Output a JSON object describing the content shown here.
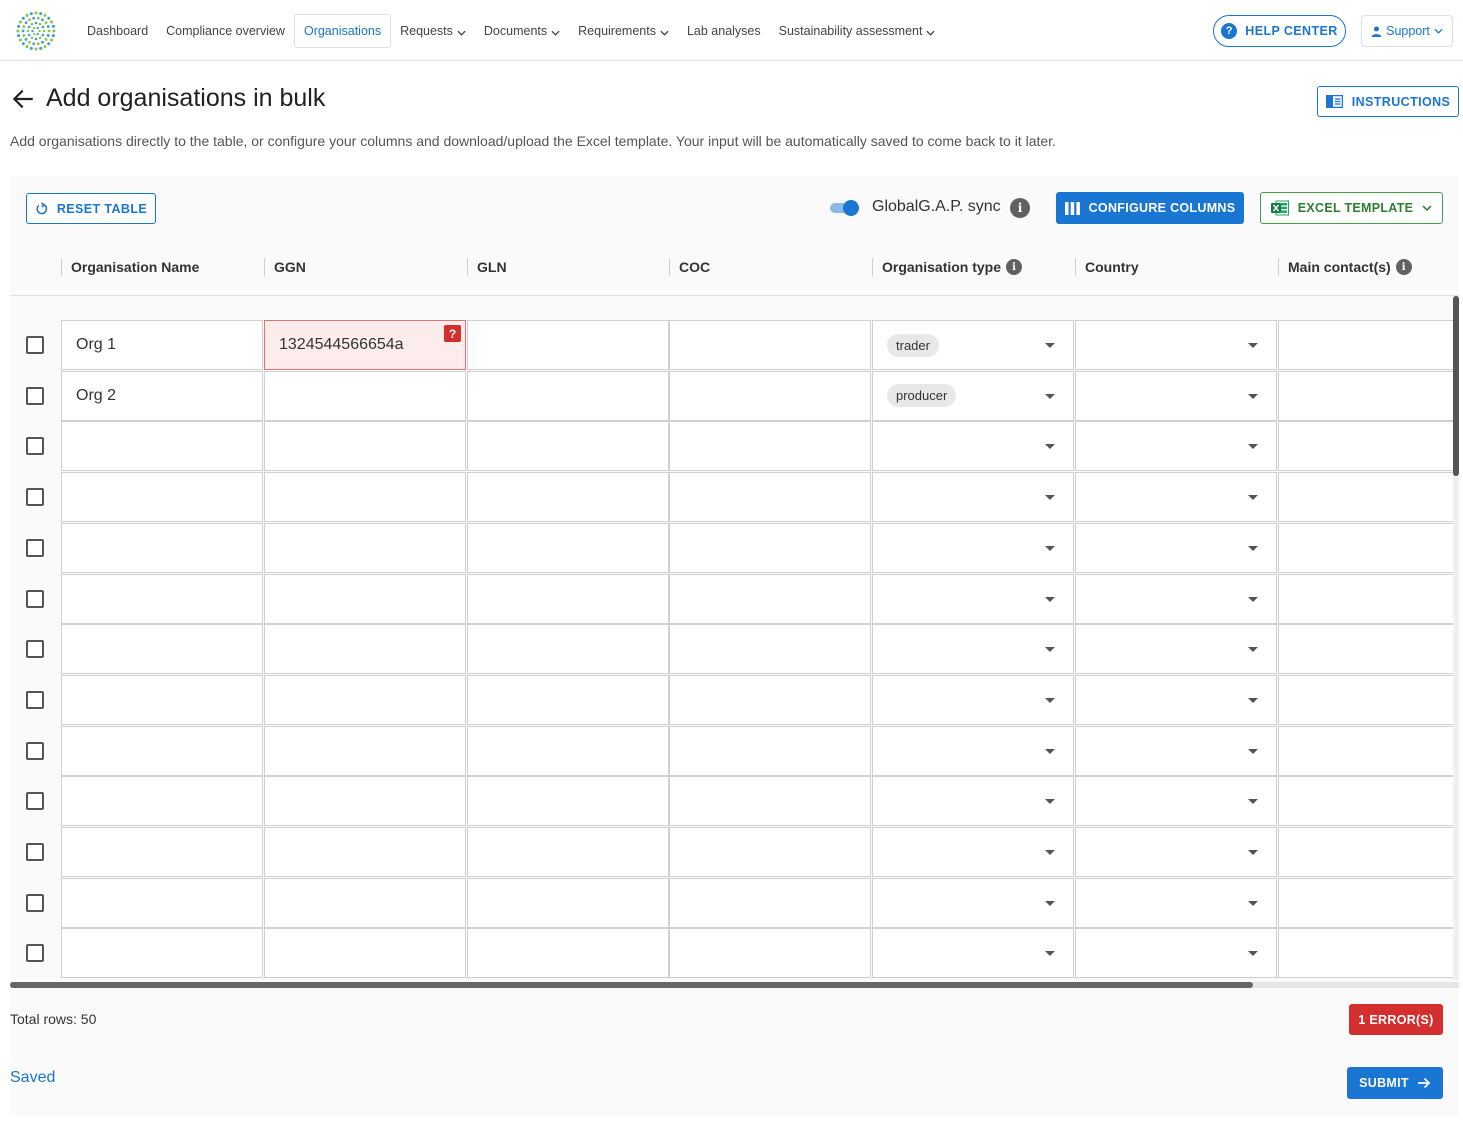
{
  "nav": {
    "items": [
      {
        "label": "Dashboard",
        "dropdown": false,
        "active": false
      },
      {
        "label": "Compliance overview",
        "dropdown": false,
        "active": false
      },
      {
        "label": "Organisations",
        "dropdown": false,
        "active": true
      },
      {
        "label": "Requests",
        "dropdown": true,
        "active": false
      },
      {
        "label": "Documents",
        "dropdown": true,
        "active": false
      },
      {
        "label": "Requirements",
        "dropdown": true,
        "active": false
      },
      {
        "label": "Lab analyses",
        "dropdown": false,
        "active": false
      },
      {
        "label": "Sustainability assessment",
        "dropdown": true,
        "active": false
      }
    ],
    "help_label": "HELP CENTER",
    "support_label": "Support"
  },
  "page": {
    "title": "Add organisations in bulk",
    "instructions_label": "INSTRUCTIONS",
    "description": "Add organisations directly to the table, or configure your columns and download/upload the Excel template. Your input will be automatically saved to come back to it later."
  },
  "toolbar": {
    "reset_label": "RESET TABLE",
    "sync_label": "GlobalG.A.P. sync",
    "sync_enabled": true,
    "configure_label": "CONFIGURE COLUMNS",
    "excel_label": "EXCEL TEMPLATE"
  },
  "table": {
    "columns": [
      {
        "label": "Organisation Name",
        "info": false
      },
      {
        "label": "GGN",
        "info": false
      },
      {
        "label": "GLN",
        "info": false
      },
      {
        "label": "COC",
        "info": false
      },
      {
        "label": "Organisation type",
        "info": true
      },
      {
        "label": "Country",
        "info": false
      },
      {
        "label": "Main contact(s)",
        "info": true
      }
    ],
    "rows": [
      {
        "name": "Org 1",
        "ggn": "1324544566654a",
        "ggn_error": true,
        "gln": "",
        "coc": "",
        "org_type": "trader",
        "country": "",
        "contact": ""
      },
      {
        "name": "Org 2",
        "ggn": "",
        "ggn_error": false,
        "gln": "",
        "coc": "",
        "org_type": "producer",
        "country": "",
        "contact": ""
      },
      {
        "name": "",
        "ggn": "",
        "ggn_error": false,
        "gln": "",
        "coc": "",
        "org_type": "",
        "country": "",
        "contact": ""
      },
      {
        "name": "",
        "ggn": "",
        "ggn_error": false,
        "gln": "",
        "coc": "",
        "org_type": "",
        "country": "",
        "contact": ""
      },
      {
        "name": "",
        "ggn": "",
        "ggn_error": false,
        "gln": "",
        "coc": "",
        "org_type": "",
        "country": "",
        "contact": ""
      },
      {
        "name": "",
        "ggn": "",
        "ggn_error": false,
        "gln": "",
        "coc": "",
        "org_type": "",
        "country": "",
        "contact": ""
      },
      {
        "name": "",
        "ggn": "",
        "ggn_error": false,
        "gln": "",
        "coc": "",
        "org_type": "",
        "country": "",
        "contact": ""
      },
      {
        "name": "",
        "ggn": "",
        "ggn_error": false,
        "gln": "",
        "coc": "",
        "org_type": "",
        "country": "",
        "contact": ""
      },
      {
        "name": "",
        "ggn": "",
        "ggn_error": false,
        "gln": "",
        "coc": "",
        "org_type": "",
        "country": "",
        "contact": ""
      },
      {
        "name": "",
        "ggn": "",
        "ggn_error": false,
        "gln": "",
        "coc": "",
        "org_type": "",
        "country": "",
        "contact": ""
      },
      {
        "name": "",
        "ggn": "",
        "ggn_error": false,
        "gln": "",
        "coc": "",
        "org_type": "",
        "country": "",
        "contact": ""
      },
      {
        "name": "",
        "ggn": "",
        "ggn_error": false,
        "gln": "",
        "coc": "",
        "org_type": "",
        "country": "",
        "contact": ""
      },
      {
        "name": "",
        "ggn": "",
        "ggn_error": false,
        "gln": "",
        "coc": "",
        "org_type": "",
        "country": "",
        "contact": ""
      }
    ],
    "error_marker": "?"
  },
  "footer": {
    "total_rows": "Total rows: 50",
    "errors_label": "1 ERROR(S)",
    "saved_label": "Saved",
    "submit_label": "SUBMIT"
  },
  "colors": {
    "primary": "#1976d2",
    "error": "#d32f2f",
    "excel_green": "#2e7d32"
  }
}
